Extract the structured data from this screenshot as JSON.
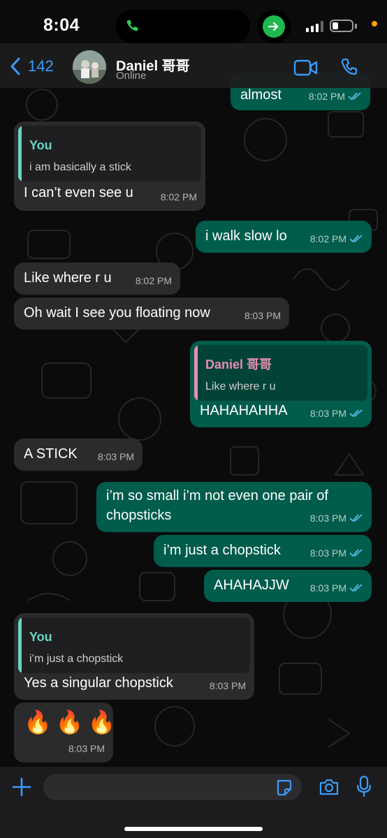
{
  "status_bar": {
    "time": "8:04",
    "battery_level": 0.2
  },
  "header": {
    "back_count": "142",
    "contact_name": "Daniel 哥哥",
    "contact_status": "Online"
  },
  "colors": {
    "incoming_bubble": "#2b2b2d",
    "outgoing_bubble": "#005c4b",
    "accent_blue": "#3b9cff",
    "read_ticks": "#53bdeb",
    "quote_you": "#6ad3c4",
    "quote_daniel": "#e58fb0"
  },
  "messages": [
    {
      "id": "m1",
      "dir": "out",
      "text": "almost",
      "time": "8:02 PM",
      "read": true
    },
    {
      "id": "m2",
      "dir": "in",
      "quote": {
        "author": "You",
        "text": "i am basically a stick"
      },
      "text": "I can’t even see u",
      "time": "8:02 PM"
    },
    {
      "id": "m3",
      "dir": "out",
      "text": "i walk slow lo",
      "time": "8:02 PM",
      "read": true
    },
    {
      "id": "m4",
      "dir": "in",
      "text": "Like where r u",
      "time": "8:02 PM"
    },
    {
      "id": "m5",
      "dir": "in",
      "text": "Oh wait I see you floating now",
      "time": "8:03 PM"
    },
    {
      "id": "m6",
      "dir": "out",
      "quote": {
        "author": "Daniel 哥哥",
        "text": "Like where r u"
      },
      "text": "HAHAHAHHA",
      "time": "8:03 PM",
      "read": true
    },
    {
      "id": "m7",
      "dir": "in",
      "text": "A STICK",
      "time": "8:03 PM"
    },
    {
      "id": "m8",
      "dir": "out",
      "line1": "i’m so small i’m not even one pair of",
      "line2": "chopsticks",
      "time": "8:03 PM",
      "read": true
    },
    {
      "id": "m9",
      "dir": "out",
      "text": "i’m just a chopstick",
      "time": "8:03 PM",
      "read": true
    },
    {
      "id": "m10",
      "dir": "out",
      "text": "AHAHAJJW",
      "time": "8:03 PM",
      "read": true
    },
    {
      "id": "m11",
      "dir": "in",
      "quote": {
        "author": "You",
        "text": "i’m just a chopstick"
      },
      "text": "Yes a singular chopstick",
      "time": "8:03 PM"
    },
    {
      "id": "m12",
      "dir": "in",
      "text": "🔥🔥🔥",
      "time": "8:03 PM"
    }
  ],
  "composer": {
    "placeholder": ""
  }
}
